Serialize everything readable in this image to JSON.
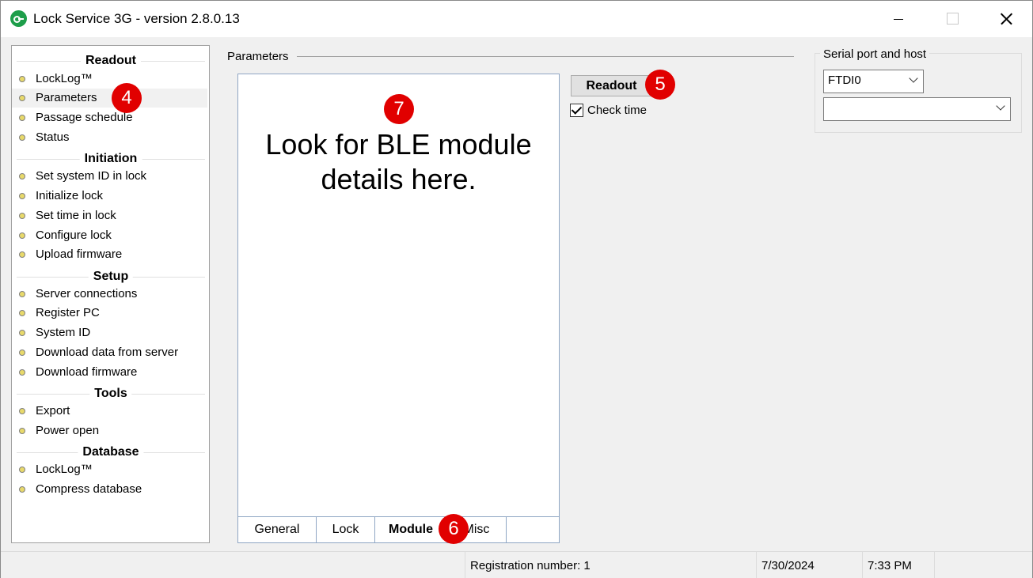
{
  "window": {
    "title": "Lock Service 3G - version 2.8.0.13"
  },
  "nav": {
    "sections": {
      "readout": "Readout",
      "initiation": "Initiation",
      "setup": "Setup",
      "tools": "Tools",
      "database": "Database"
    },
    "items": {
      "locklog": "LockLog™",
      "parameters": "Parameters",
      "passage_schedule": "Passage schedule",
      "status": "Status",
      "set_system_id": "Set system ID in lock",
      "initialize_lock": "Initialize lock",
      "set_time": "Set time in lock",
      "configure_lock": "Configure lock",
      "upload_firmware": "Upload firmware",
      "server_connections": "Server connections",
      "register_pc": "Register PC",
      "system_id": "System ID",
      "download_data": "Download data from server",
      "download_firmware": "Download firmware",
      "export": "Export",
      "power_open": "Power open",
      "db_locklog": "LockLog™",
      "compress_database": "Compress database"
    },
    "selected": "parameters"
  },
  "main": {
    "caption": "Parameters",
    "tabs": {
      "general": "General",
      "lock": "Lock",
      "module": "Module",
      "misc": "Misc"
    },
    "active_tab": "Module",
    "readout_button": "Readout",
    "check_time_label": "Check time",
    "check_time_checked": true
  },
  "serial": {
    "caption": "Serial port and host",
    "port_value": "FTDI0",
    "host_value": ""
  },
  "annotations": {
    "markers": {
      "m4": "4",
      "m5": "5",
      "m6": "6",
      "m7": "7"
    },
    "note_line1": "Look for BLE module",
    "note_line2": "details here."
  },
  "status": {
    "registration": "Registration number: 1",
    "date": "7/30/2024",
    "time": "7:33 PM"
  },
  "colors": {
    "marker_red": "#e10000",
    "app_icon_green": "#1e9e4a"
  }
}
